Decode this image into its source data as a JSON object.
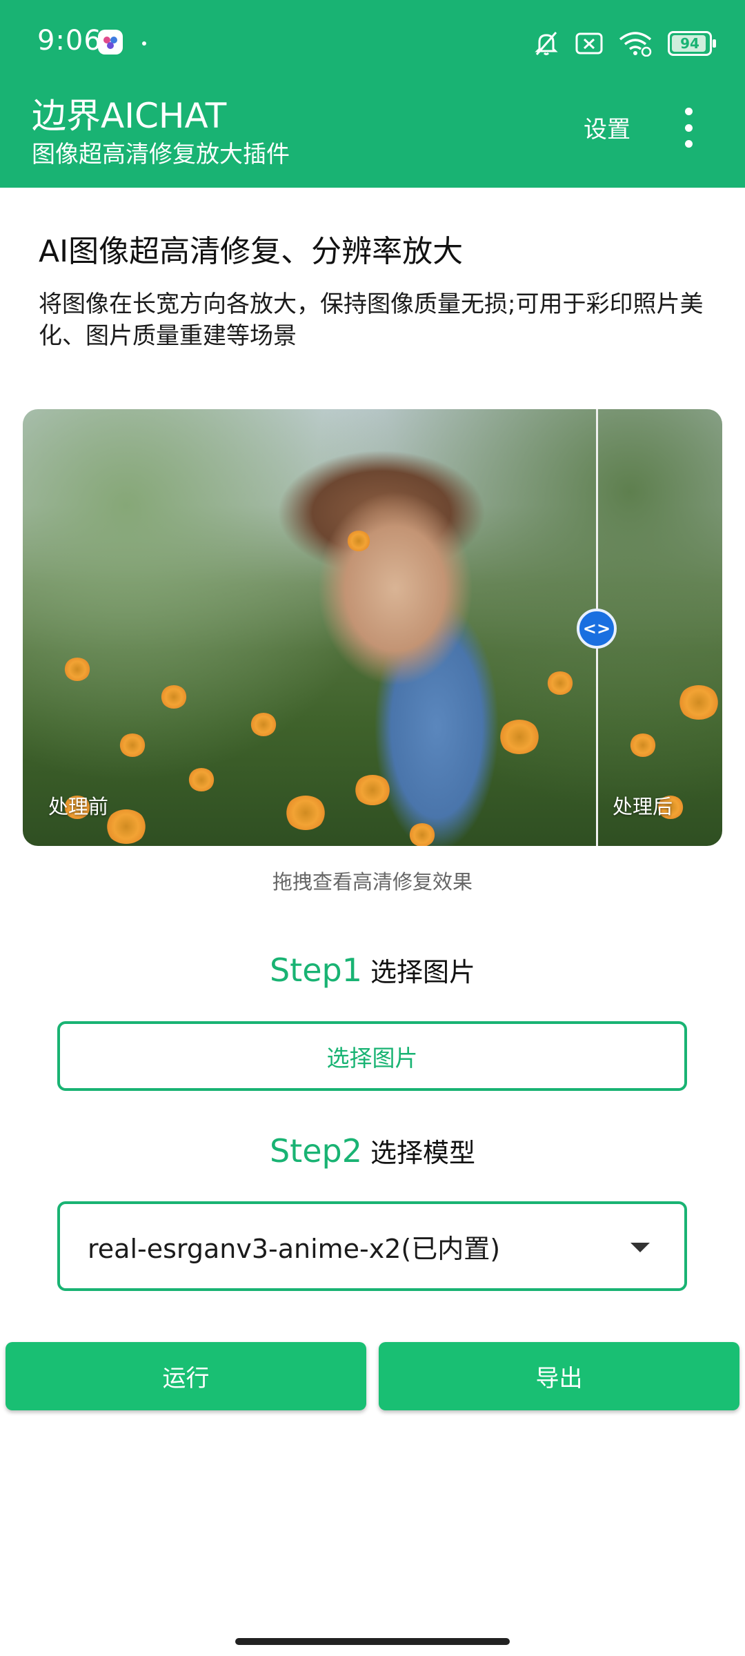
{
  "status_bar": {
    "time": "9:06",
    "icons": [
      "app-notification-icon",
      "mute-icon",
      "sim-off-icon",
      "wifi-icon",
      "battery-icon"
    ],
    "battery_level": "94"
  },
  "app_bar": {
    "title": "边界AICHAT",
    "subtitle": "图像超高清修复放大插件",
    "settings_label": "设置",
    "more_icon": "more-vert-icon",
    "background_color": "#19b373"
  },
  "intro": {
    "title": "AI图像超高清修复、分辨率放大",
    "description": "将图像在长宽方向各放大，保持图像质量无损;可用于彩印照片美化、图片质量重建等场景"
  },
  "compare": {
    "before_label": "处理前",
    "after_label": "处理后",
    "handle_glyph": "<>",
    "hint": "拖拽查看高清修复效果"
  },
  "step1": {
    "number": "Step1",
    "text": "选择图片",
    "button_label": "选择图片"
  },
  "step2": {
    "number": "Step2",
    "text": "选择模型",
    "selected_model": "real-esrganv3-anime-x2(已内置)"
  },
  "actions": {
    "run_label": "运行",
    "export_label": "导出",
    "accent_color": "#19bf73"
  }
}
